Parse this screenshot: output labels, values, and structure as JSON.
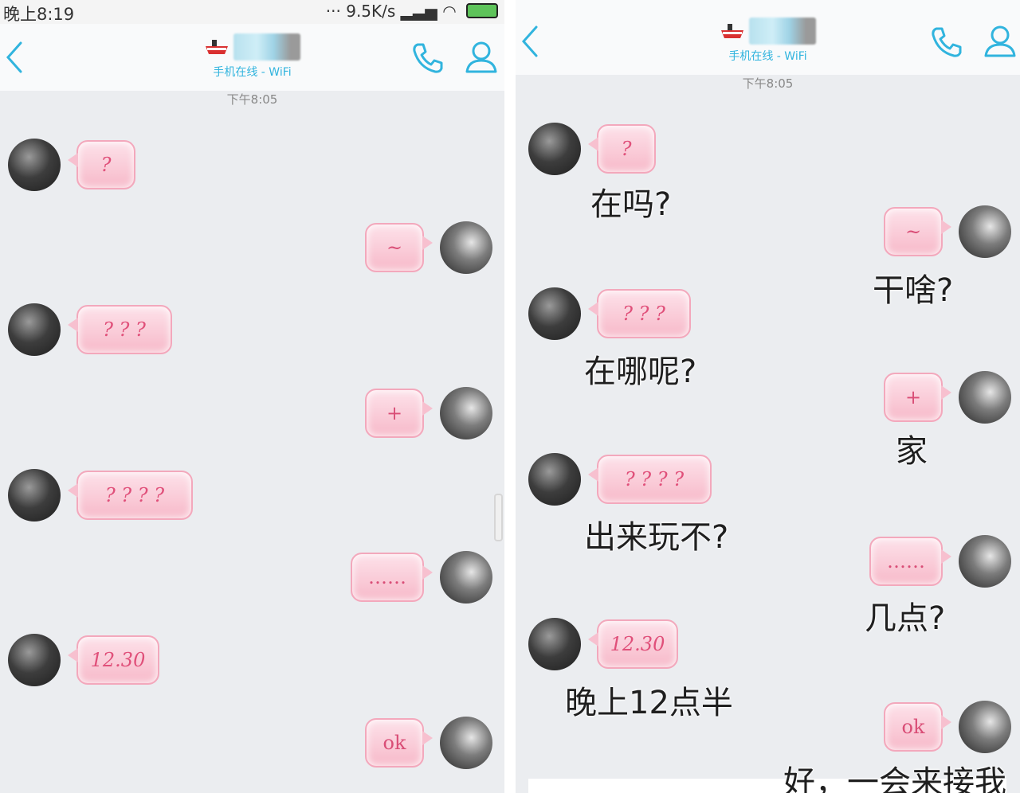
{
  "colors": {
    "accent": "#31b4de",
    "bubble": "#f7b9c9",
    "bubble_text": "#e0507a",
    "background": "#ebedf0"
  },
  "left": {
    "status": {
      "time": "晚上8:19",
      "network_speed": "9.5K/s",
      "battery": "80"
    },
    "header": {
      "subtitle": "手机在线 - WiFi"
    },
    "timestamp": "下午8:05",
    "messages": [
      {
        "side": "in",
        "text": "?"
      },
      {
        "side": "out",
        "text": "~"
      },
      {
        "side": "in",
        "text": "? ? ?"
      },
      {
        "side": "out",
        "text": "+"
      },
      {
        "side": "in",
        "text": "? ? ? ?"
      },
      {
        "side": "out",
        "text": "……"
      },
      {
        "side": "in",
        "text": "12.30"
      },
      {
        "side": "out",
        "text": "ok"
      }
    ]
  },
  "right": {
    "header": {
      "subtitle": "手机在线 - WiFi"
    },
    "timestamp": "下午8:05",
    "messages": [
      {
        "side": "in",
        "text": "?",
        "caption": "在吗?"
      },
      {
        "side": "out",
        "text": "~",
        "caption": "干啥?"
      },
      {
        "side": "in",
        "text": "? ? ?",
        "caption": "在哪呢?"
      },
      {
        "side": "out",
        "text": "+",
        "caption": "家"
      },
      {
        "side": "in",
        "text": "? ? ? ?",
        "caption": "出来玩不?"
      },
      {
        "side": "out",
        "text": "……",
        "caption": "几点?"
      },
      {
        "side": "in",
        "text": "12.30",
        "caption": "晚上12点半"
      },
      {
        "side": "out",
        "text": "ok",
        "caption": "好，一会来接我"
      }
    ]
  }
}
